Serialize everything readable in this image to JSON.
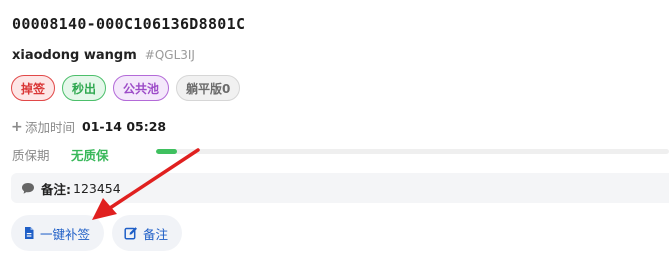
{
  "serial": "00008140-000C106136D8801C",
  "user": {
    "name": "xiaodong wangm",
    "tag": "#QGL3IJ"
  },
  "tags": [
    {
      "label": "掉签",
      "style": "red"
    },
    {
      "label": "秒出",
      "style": "green"
    },
    {
      "label": "公共池",
      "style": "purple"
    },
    {
      "label": "躺平版0",
      "style": "gray"
    }
  ],
  "added": {
    "label": "添加时间",
    "value": "01-14 05:28"
  },
  "warranty": {
    "label": "质保期",
    "value": "无质保",
    "progress_percent": 4
  },
  "note": {
    "label": "备注:",
    "value": "123454"
  },
  "actions": {
    "resign_label": "一键补签",
    "note_label": "备注"
  },
  "colors": {
    "accent_blue": "#1f5fc7",
    "green": "#39b85a",
    "red": "#e14848",
    "purple": "#b36ad8",
    "arrow_red": "#e0201f"
  },
  "icons": {
    "add_time": "plus-icon",
    "note": "chat-bubble-icon",
    "resign": "document-icon",
    "edit_note": "edit-icon"
  }
}
